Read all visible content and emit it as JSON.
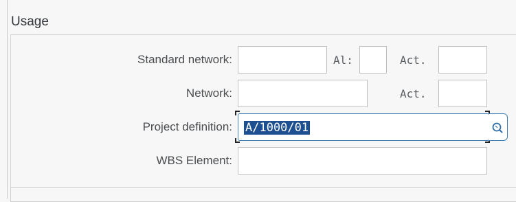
{
  "group": {
    "title": "Usage"
  },
  "fields": {
    "standard_network": {
      "label": "Standard network:",
      "value": ""
    },
    "al": {
      "label": "Al:",
      "value": ""
    },
    "std_act": {
      "label": "Act.",
      "value": ""
    },
    "network": {
      "label": "Network:",
      "value": ""
    },
    "net_act": {
      "label": "Act.",
      "value": ""
    },
    "project_definition": {
      "label": "Project definition:",
      "value": "A/1000/01"
    },
    "wbs_element": {
      "label": "WBS Element:",
      "value": ""
    }
  },
  "icons": {
    "search": "search-help-icon"
  },
  "colors": {
    "accent": "#3d7fb5",
    "selection": "#1d4f91"
  }
}
